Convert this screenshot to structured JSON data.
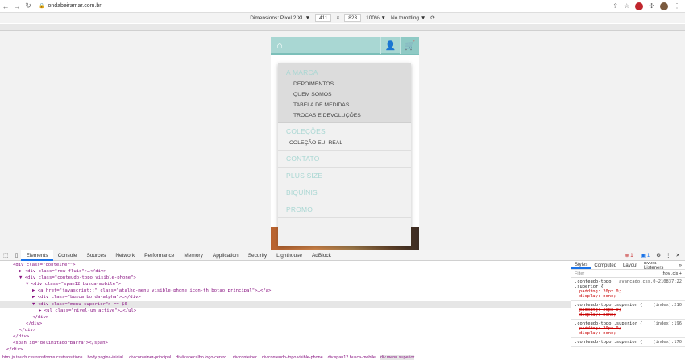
{
  "browser": {
    "url": "ondabeiramar.com.br"
  },
  "device_toolbar": {
    "dimensions_label": "Dimensions: Pixel 2 XL ▼",
    "width": "411",
    "x": "×",
    "height": "823",
    "zoom": "100% ▼",
    "throttle": "No throttling ▼"
  },
  "site": {
    "menu": {
      "marca": "A MARCA",
      "marca_items": [
        "DEPOIMENTOS",
        "QUEM SOMOS",
        "TABELA DE MEDIDAS",
        "TROCAS E DEVOLUÇÕES"
      ],
      "colecoes": "COLEÇÕES",
      "colecoes_items": [
        "COLEÇÃO EU, REAL"
      ],
      "contato": "CONTATO",
      "plus_size": "PLUS SIZE",
      "biquinis": "BIQUÍNIS",
      "promo": "PROMO"
    }
  },
  "devtools": {
    "tabs": [
      "Elements",
      "Console",
      "Sources",
      "Network",
      "Performance",
      "Memory",
      "Application",
      "Security",
      "Lighthouse",
      "AdBlock"
    ],
    "active_tab": "Elements",
    "error_count": "1",
    "info_count": "1",
    "dom_lines": [
      {
        "indent": 2,
        "html": "<div class=\"conteiner\">"
      },
      {
        "indent": 3,
        "html": "▶ <div class=\"row-fluid\">…</div>"
      },
      {
        "indent": 3,
        "html": "▼ <div class=\"conteudo-topo visible-phone\">"
      },
      {
        "indent": 4,
        "html": "▼ <div class=\"span12 busca-mobile\">"
      },
      {
        "indent": 5,
        "html": "▶ <a href=\"javascript:;\" class=\"atalho-menu visible-phone icon-th botao principal\">…</a>"
      },
      {
        "indent": 5,
        "html": "▶ <div class=\"busca borda-alpha\">…</div>"
      },
      {
        "indent": 5,
        "html": "▼ <div class=\"menu superior\"> == $0"
      },
      {
        "indent": 6,
        "html": "▶ <ul class=\"nivel-um active\">…</ul>"
      },
      {
        "indent": 5,
        "html": "</div>"
      },
      {
        "indent": 4,
        "html": "</div>"
      },
      {
        "indent": 3,
        "html": "</div>"
      },
      {
        "indent": 2,
        "html": "</div>"
      },
      {
        "indent": 2,
        "html": "<span id=\"delimitadorBarra\"></span>"
      },
      {
        "indent": 1,
        "html": "</div>"
      },
      {
        "indent": 1,
        "html": "▶ <div class=\"secao-banners\">…</div>"
      }
    ],
    "breadcrumbs": [
      "html.js.touch.csstransforms.csstransitions",
      "body.pagina-inicial.",
      "div.conteiner-principal",
      "div#cabecalho.logo-centro.",
      "div.conteiner",
      "div.conteudo-topo.visible-phone",
      "div.span12.busca-mobile",
      "div.menu.superior"
    ],
    "styles": {
      "tabs": [
        "Styles",
        "Computed",
        "Layout",
        "Event Listeners",
        "»"
      ],
      "filter_placeholder": "Filter",
      "filter_tools": ":hov .cls +",
      "rules": [
        {
          "selector": ".conteudo-topo .superior {",
          "source": "avancado.css.0-210837:22",
          "props": [
            "padding: 20px 0;",
            "display: none;"
          ],
          "strike": [
            false,
            true
          ]
        },
        {
          "selector": ".conteudo-topo .superior {",
          "source": "(index):210",
          "props": [
            "padding: 20px 0;",
            "display: none;"
          ],
          "strike": [
            true,
            true
          ]
        },
        {
          "selector": ".conteudo-topo .superior {",
          "source": "(index):196",
          "props": [
            "padding: 20px 0;",
            "display: none;"
          ],
          "strike": [
            true,
            true
          ]
        },
        {
          "selector": ".conteudo-topo .superior {",
          "source": "(index):170",
          "props": [],
          "strike": []
        }
      ]
    }
  }
}
